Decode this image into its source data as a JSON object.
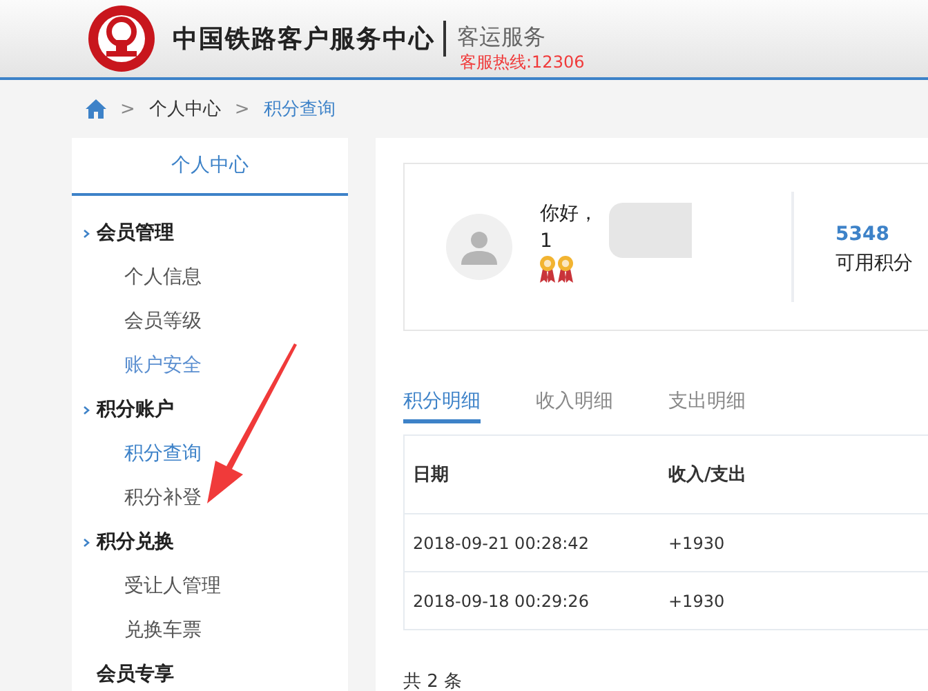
{
  "header": {
    "title": "中国铁路客户服务中心",
    "subtitle": "客运服务",
    "hotline": "客服热线:12306"
  },
  "breadcrumb": [
    {
      "separator": ">",
      "label": "个人中心"
    },
    {
      "separator": ">",
      "label": "积分查询"
    }
  ],
  "sidebar": {
    "title": "个人中心",
    "items": [
      {
        "kind": "group",
        "label": "会员管理"
      },
      {
        "kind": "link",
        "label": "个人信息",
        "selected": false,
        "visited": false
      },
      {
        "kind": "link",
        "label": "会员等级",
        "selected": false,
        "visited": false
      },
      {
        "kind": "link",
        "label": "账户安全",
        "selected": false,
        "visited": true
      },
      {
        "kind": "group",
        "label": "积分账户"
      },
      {
        "kind": "link",
        "label": "积分查询",
        "selected": true,
        "visited": false
      },
      {
        "kind": "link",
        "label": "积分补登",
        "selected": false,
        "visited": false
      },
      {
        "kind": "group",
        "label": "积分兑换"
      },
      {
        "kind": "link",
        "label": "受让人管理",
        "selected": false,
        "visited": false
      },
      {
        "kind": "link",
        "label": "兑换车票",
        "selected": false,
        "visited": false
      },
      {
        "kind": "heading",
        "label": "会员专享"
      }
    ]
  },
  "profile": {
    "greeting": "你好，",
    "account": "1",
    "points": "5348",
    "points_label": "可用积分"
  },
  "tabs": [
    {
      "label": "积分明细",
      "selected": true
    },
    {
      "label": "收入明细",
      "selected": false
    },
    {
      "label": "支出明细",
      "selected": false
    }
  ],
  "table": {
    "columns": [
      "日期",
      "收入/支出"
    ],
    "rows": [
      [
        "2018-09-21 00:28:42",
        "+1930"
      ],
      [
        "2018-09-18 00:29:26",
        "+1930"
      ]
    ]
  },
  "total": "共 2 条"
}
